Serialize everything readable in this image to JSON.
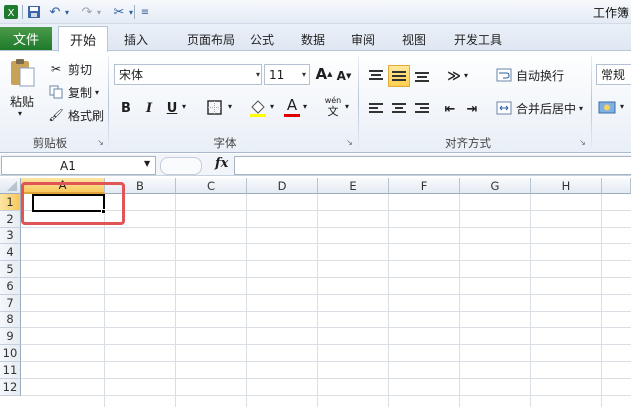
{
  "window": {
    "title": "工作簿"
  },
  "quick_access": [
    "save-icon",
    "undo-icon",
    "redo-icon",
    "customize-icon"
  ],
  "tabs": {
    "file": "文件",
    "home": "开始",
    "insert": "插入",
    "page_layout": "页面布局",
    "formulas": "公式",
    "data": "数据",
    "review": "审阅",
    "view": "视图",
    "developer": "开发工具"
  },
  "clipboard": {
    "paste": "粘贴",
    "cut": "剪切",
    "copy": "复制",
    "format_painter": "格式刷",
    "label": "剪贴板"
  },
  "font": {
    "name": "宋体",
    "size": "11",
    "bold": "B",
    "italic": "I",
    "underline": "U",
    "grow": "A",
    "shrink": "A",
    "font_color_letter": "A",
    "phonetic": "wén",
    "label": "字体",
    "fill_color": "#ffff00",
    "font_color": "#e00000"
  },
  "alignment": {
    "wrap": "自动换行",
    "merge": "合并后居中",
    "label": "对齐方式"
  },
  "number": {
    "format": "常规"
  },
  "formula_bar": {
    "cell_ref": "A1",
    "fx": "fx",
    "value": ""
  },
  "grid": {
    "columns": [
      "A",
      "B",
      "C",
      "D",
      "E",
      "F",
      "G",
      "H"
    ],
    "rows": [
      "1",
      "2",
      "3",
      "4",
      "5",
      "6",
      "7",
      "8",
      "9",
      "10",
      "11",
      "12"
    ],
    "selected_column": "A",
    "selected_row": "1",
    "highlight_color": "#e05555"
  }
}
